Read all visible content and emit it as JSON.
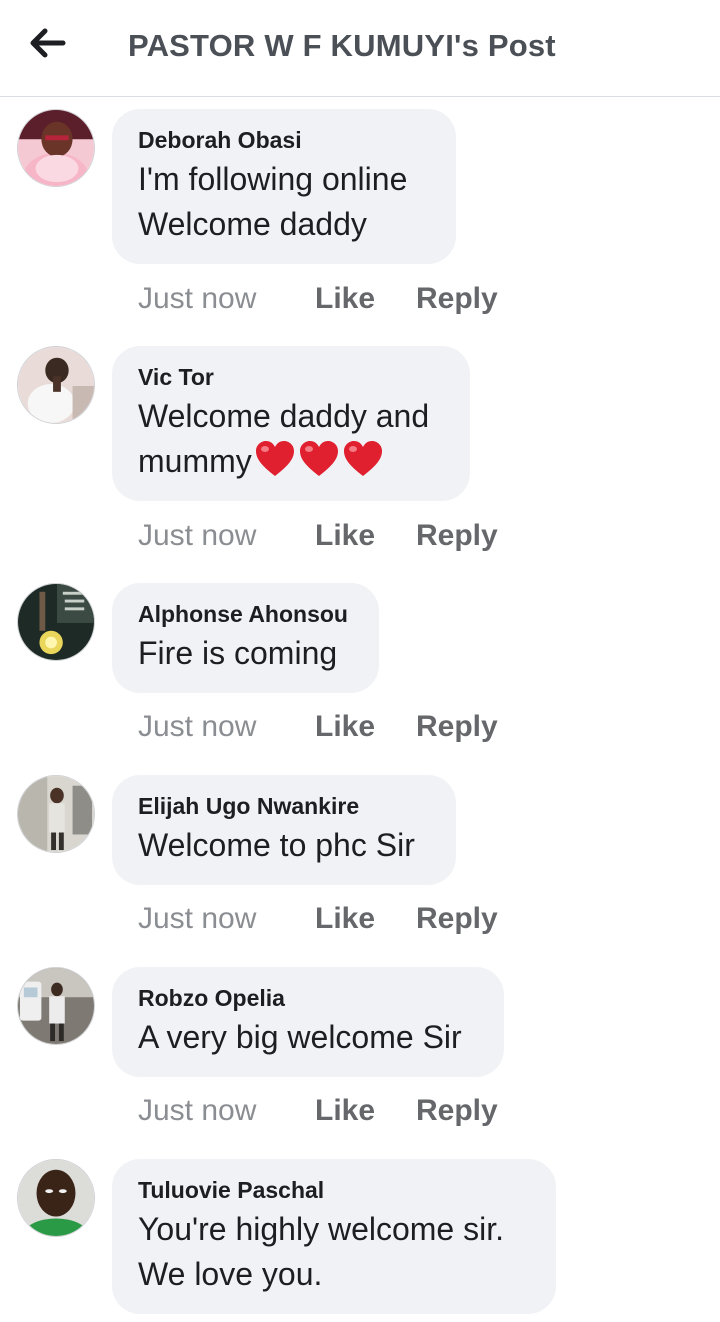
{
  "header": {
    "title": "PASTOR W F KUMUYI's Post",
    "back_icon": "arrow-left-icon"
  },
  "colors": {
    "bubble": "#f0f2f5",
    "meta_text": "#8a8d91",
    "action_text": "#65676b",
    "heart": "#e0202f"
  },
  "comments": [
    {
      "author": "Deborah Obasi",
      "lines": [
        "I'm following online",
        "Welcome daddy"
      ],
      "time": "Just now",
      "like": "Like",
      "reply": "Reply"
    },
    {
      "author": "Vic Tor",
      "lines": [
        "Welcome daddy and",
        "mummy"
      ],
      "emoji": "heart-icon x3",
      "time": "Just now",
      "like": "Like",
      "reply": "Reply"
    },
    {
      "author": "Alphonse Ahonsou",
      "lines": [
        "Fire is coming"
      ],
      "time": "Just now",
      "like": "Like",
      "reply": "Reply"
    },
    {
      "author": "Elijah Ugo Nwankire",
      "lines": [
        "Welcome to phc Sir"
      ],
      "time": "Just now",
      "like": "Like",
      "reply": "Reply"
    },
    {
      "author": "Robzo Opelia",
      "lines": [
        "A very big welcome Sir"
      ],
      "time": "Just now",
      "like": "Like",
      "reply": "Reply"
    },
    {
      "author": "Tuluovie Paschal",
      "lines": [
        "You're highly welcome sir.",
        "We love you."
      ]
    }
  ]
}
